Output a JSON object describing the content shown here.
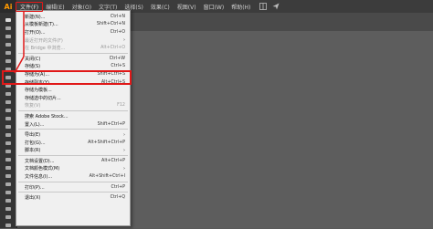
{
  "app_logo": "Ai",
  "menubar": [
    {
      "label": "文件(F)"
    },
    {
      "label": "编辑(E)"
    },
    {
      "label": "对象(O)"
    },
    {
      "label": "文字(T)"
    },
    {
      "label": "选择(S)"
    },
    {
      "label": "效果(C)"
    },
    {
      "label": "视图(V)"
    },
    {
      "label": "窗口(W)"
    },
    {
      "label": "帮助(H)"
    }
  ],
  "file_menu": {
    "items": [
      {
        "label": "新建(N)...",
        "shortcut": "Ctrl+N"
      },
      {
        "label": "从模板新建(T)...",
        "shortcut": "Shift+Ctrl+N"
      },
      {
        "label": "打开(O)...",
        "shortcut": "Ctrl+O"
      },
      {
        "label": "最近打开的文件(F)",
        "shortcut": ""
      },
      {
        "label": "在 Bridge 中浏览...",
        "shortcut": "Alt+Ctrl+O"
      },
      {
        "label": "关闭(C)",
        "shortcut": "Ctrl+W"
      },
      {
        "label": "存储(S)",
        "shortcut": "Ctrl+S"
      },
      {
        "label": "存储为(A)...",
        "shortcut": "Shift+Ctrl+S"
      },
      {
        "label": "存储副本(Y)...",
        "shortcut": "Alt+Ctrl+S"
      },
      {
        "label": "存储为模板...",
        "shortcut": ""
      },
      {
        "label": "存储选中的切片...",
        "shortcut": ""
      },
      {
        "label": "恢复(V)",
        "shortcut": "F12"
      },
      {
        "label": "搜索 Adobe Stock...",
        "shortcut": ""
      },
      {
        "label": "置入(L)...",
        "shortcut": "Shift+Ctrl+P"
      },
      {
        "label": "导出(E)",
        "shortcut": ""
      },
      {
        "label": "打包(G)...",
        "shortcut": "Alt+Shift+Ctrl+P"
      },
      {
        "label": "脚本(R)",
        "shortcut": ""
      },
      {
        "label": "文档设置(D)...",
        "shortcut": "Alt+Ctrl+P"
      },
      {
        "label": "文档颜色模式(M)",
        "shortcut": ""
      },
      {
        "label": "文件信息(I)...",
        "shortcut": "Alt+Shift+Ctrl+I"
      },
      {
        "label": "打印(P)...",
        "shortcut": "Ctrl+P"
      },
      {
        "label": "退出(X)",
        "shortcut": "Ctrl+Q"
      }
    ]
  },
  "colors": {
    "highlight": "#e01818",
    "logo": "#ff9a00"
  }
}
